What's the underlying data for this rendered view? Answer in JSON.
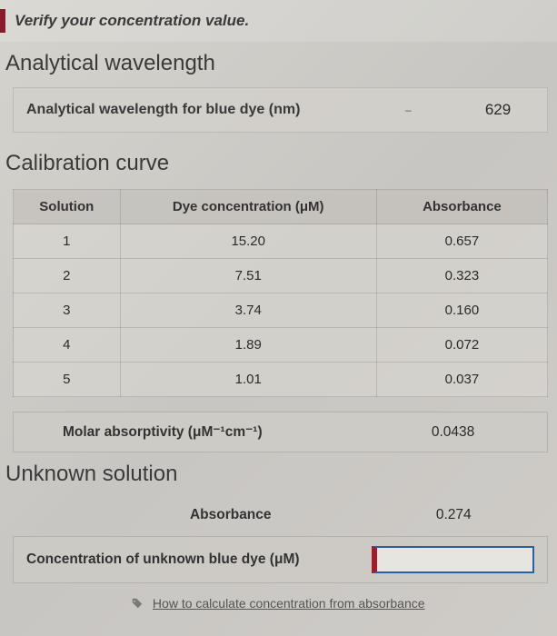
{
  "alert": {
    "text": "Verify your concentration value."
  },
  "sections": {
    "analytical_wavelength": {
      "heading": "Analytical wavelength",
      "row_label": "Analytical wavelength for blue dye (nm)",
      "dash": "–",
      "value": "629"
    },
    "calibration_curve": {
      "heading": "Calibration curve",
      "headers": {
        "solution": "Solution",
        "concentration": "Dye concentration (μM)",
        "absorbance": "Absorbance"
      },
      "rows": [
        {
          "solution": "1",
          "concentration": "15.20",
          "absorbance": "0.657"
        },
        {
          "solution": "2",
          "concentration": "7.51",
          "absorbance": "0.323"
        },
        {
          "solution": "3",
          "concentration": "3.74",
          "absorbance": "0.160"
        },
        {
          "solution": "4",
          "concentration": "1.89",
          "absorbance": "0.072"
        },
        {
          "solution": "5",
          "concentration": "1.01",
          "absorbance": "0.037"
        }
      ],
      "molar": {
        "label": "Molar absorptivity (μM⁻¹cm⁻¹)",
        "value": "0.0438"
      }
    },
    "unknown": {
      "heading": "Unknown solution",
      "absorbance": {
        "label": "Absorbance",
        "value": "0.274"
      },
      "concentration": {
        "label": "Concentration of unknown blue dye (μM)",
        "value": ""
      }
    }
  },
  "help_link": {
    "text": "How to calculate concentration from absorbance"
  }
}
